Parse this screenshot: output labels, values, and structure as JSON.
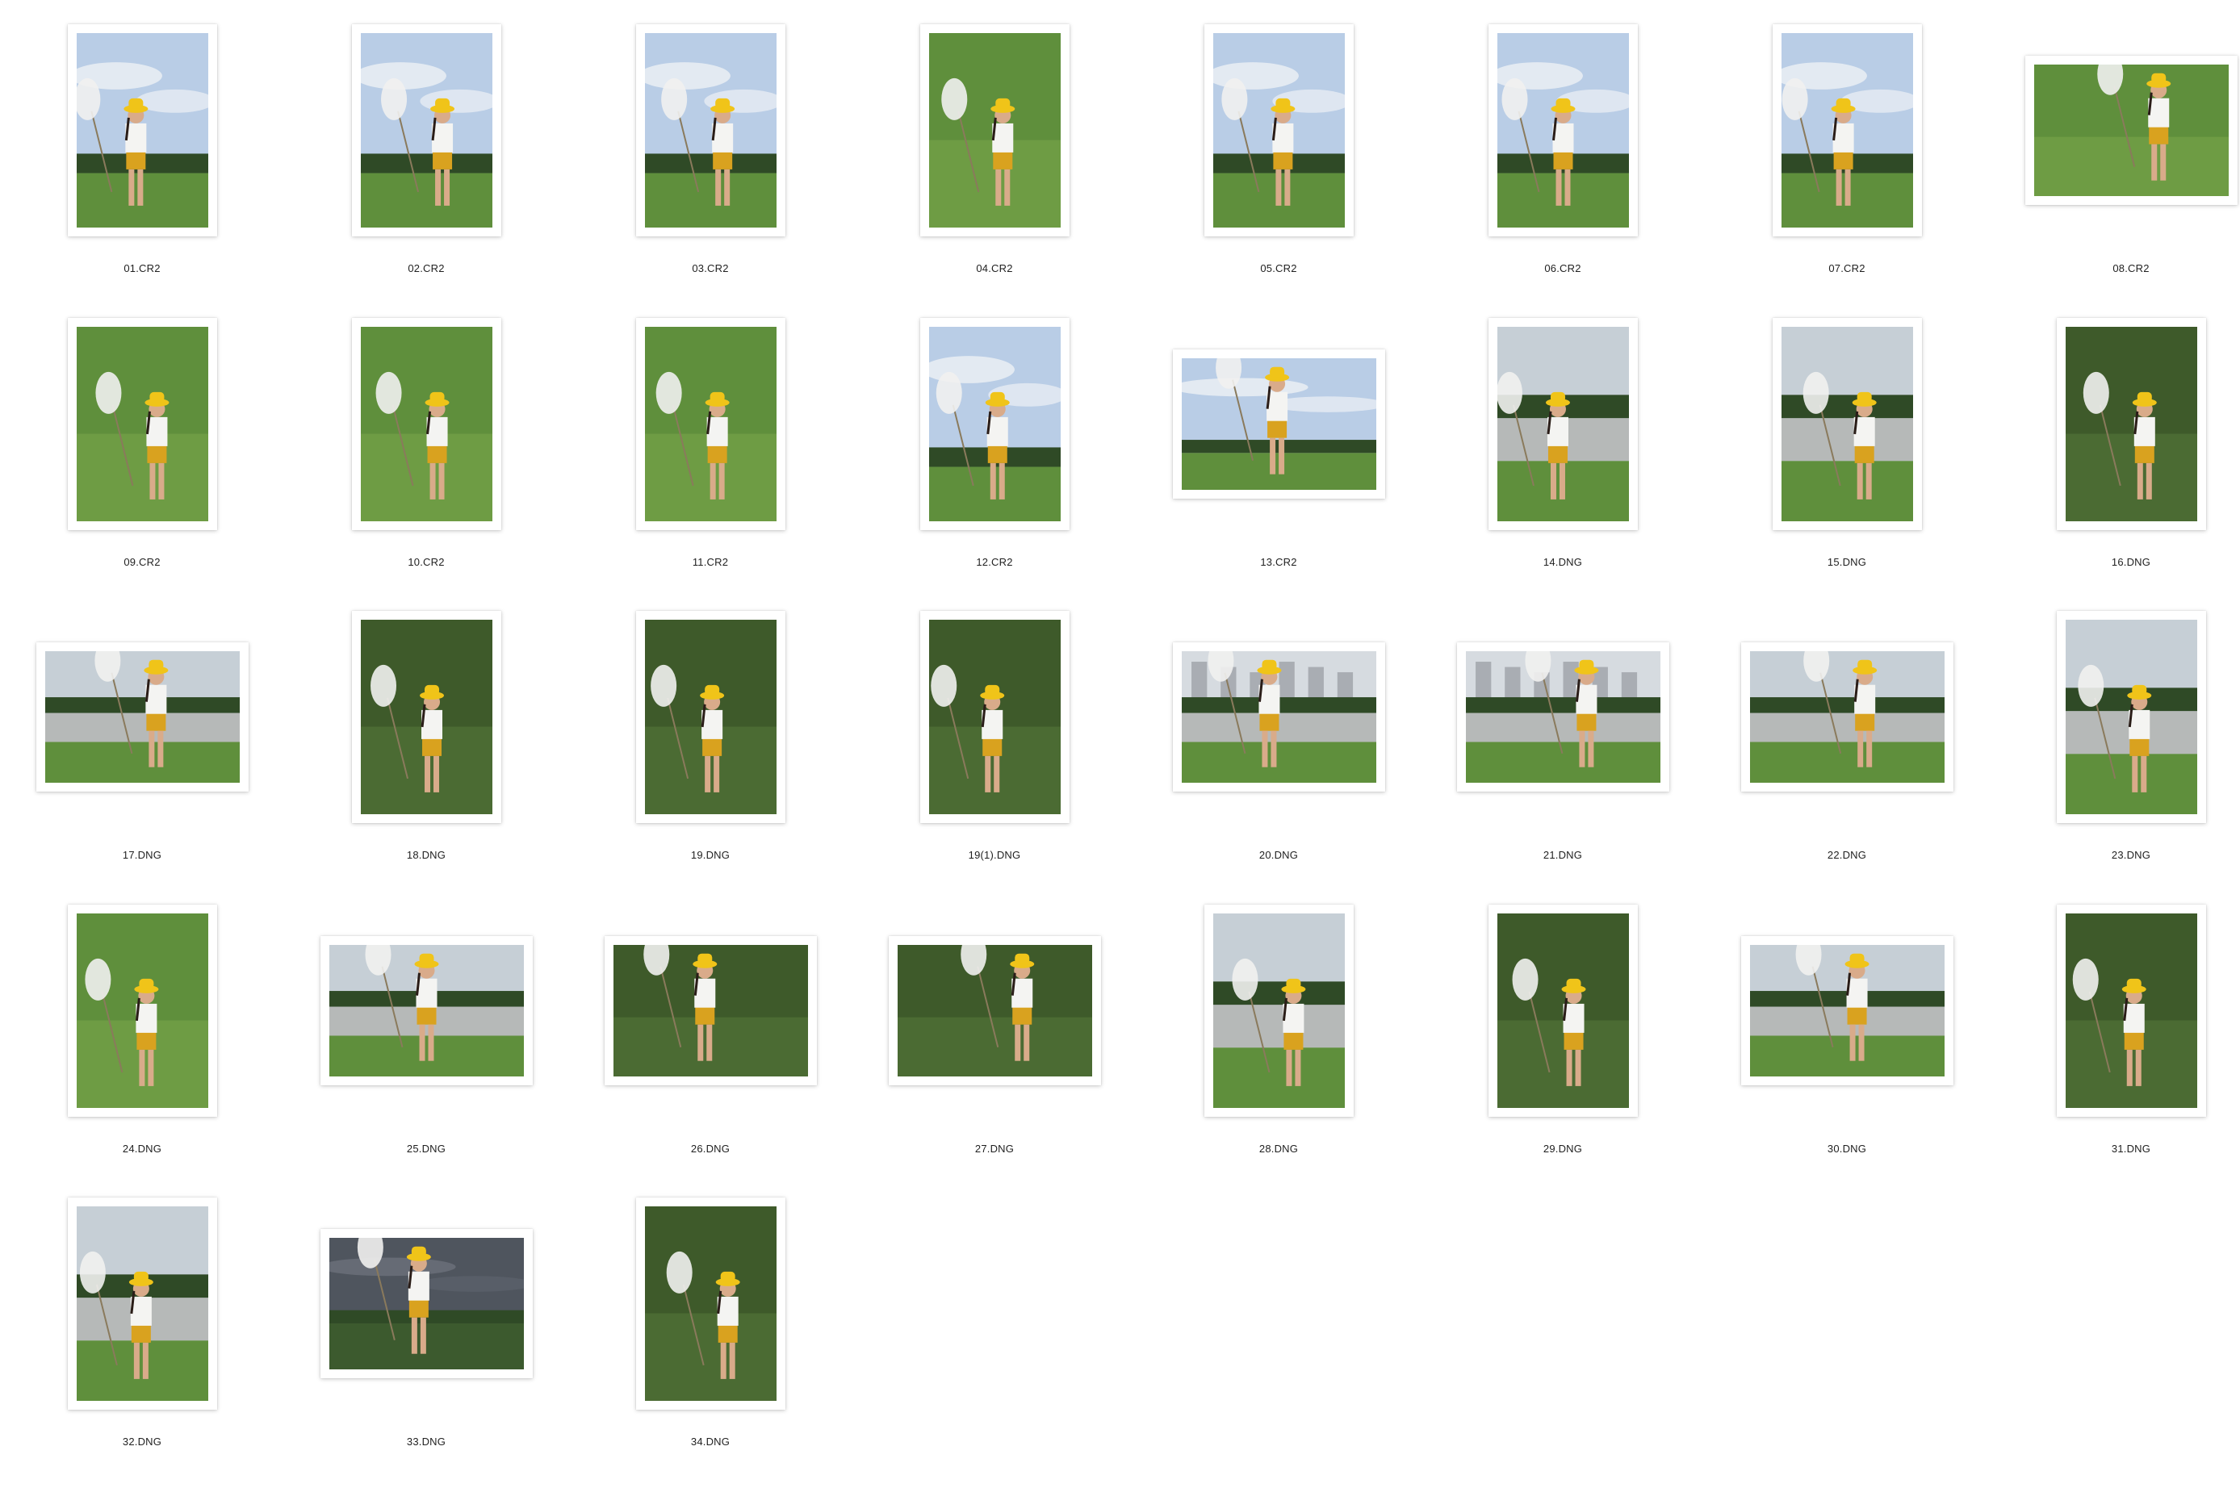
{
  "window": {
    "view": "icon-grid"
  },
  "files": [
    {
      "name": "01.CR2",
      "orientation": "portrait",
      "scene": "sky"
    },
    {
      "name": "02.CR2",
      "orientation": "portrait",
      "scene": "sky"
    },
    {
      "name": "03.CR2",
      "orientation": "portrait",
      "scene": "sky"
    },
    {
      "name": "04.CR2",
      "orientation": "portrait",
      "scene": "grass"
    },
    {
      "name": "05.CR2",
      "orientation": "portrait",
      "scene": "sky"
    },
    {
      "name": "06.CR2",
      "orientation": "portrait",
      "scene": "sky"
    },
    {
      "name": "07.CR2",
      "orientation": "portrait",
      "scene": "sky"
    },
    {
      "name": "08.CR2",
      "orientation": "landscape",
      "scene": "grass"
    },
    {
      "name": "09.CR2",
      "orientation": "portrait",
      "scene": "grass"
    },
    {
      "name": "10.CR2",
      "orientation": "portrait",
      "scene": "grass"
    },
    {
      "name": "11.CR2",
      "orientation": "portrait",
      "scene": "grass"
    },
    {
      "name": "12.CR2",
      "orientation": "portrait",
      "scene": "sky"
    },
    {
      "name": "13.CR2",
      "orientation": "landscape",
      "scene": "sky"
    },
    {
      "name": "14.DNG",
      "orientation": "portrait",
      "scene": "water"
    },
    {
      "name": "15.DNG",
      "orientation": "portrait",
      "scene": "water"
    },
    {
      "name": "16.DNG",
      "orientation": "portrait",
      "scene": "dark"
    },
    {
      "name": "17.DNG",
      "orientation": "landscape",
      "scene": "water"
    },
    {
      "name": "18.DNG",
      "orientation": "portrait",
      "scene": "dark"
    },
    {
      "name": "19.DNG",
      "orientation": "portrait",
      "scene": "dark"
    },
    {
      "name": "19(1).DNG",
      "orientation": "portrait",
      "scene": "dark"
    },
    {
      "name": "20.DNG",
      "orientation": "landscape",
      "scene": "city"
    },
    {
      "name": "21.DNG",
      "orientation": "landscape",
      "scene": "city"
    },
    {
      "name": "22.DNG",
      "orientation": "landscape",
      "scene": "water"
    },
    {
      "name": "23.DNG",
      "orientation": "portrait",
      "scene": "water"
    },
    {
      "name": "24.DNG",
      "orientation": "portrait",
      "scene": "grass"
    },
    {
      "name": "25.DNG",
      "orientation": "landscape",
      "scene": "water"
    },
    {
      "name": "26.DNG",
      "orientation": "landscape",
      "scene": "dark"
    },
    {
      "name": "27.DNG",
      "orientation": "landscape",
      "scene": "dark"
    },
    {
      "name": "28.DNG",
      "orientation": "portrait",
      "scene": "water"
    },
    {
      "name": "29.DNG",
      "orientation": "portrait",
      "scene": "dark"
    },
    {
      "name": "30.DNG",
      "orientation": "landscape",
      "scene": "water"
    },
    {
      "name": "31.DNG",
      "orientation": "portrait",
      "scene": "dark"
    },
    {
      "name": "32.DNG",
      "orientation": "portrait",
      "scene": "water"
    },
    {
      "name": "33.DNG",
      "orientation": "landscape",
      "scene": "storm"
    },
    {
      "name": "34.DNG",
      "orientation": "portrait",
      "scene": "dark"
    }
  ],
  "palette": {
    "sky": "#b9cde6",
    "cloud": "#eef1f5",
    "grass": "#5f8f3c",
    "grass_dark": "#3e5a2a",
    "water": "#b6b9b8",
    "tree": "#2f4a26",
    "shirt": "#f4f4f2",
    "shorts": "#d9a21f",
    "hat": "#f0c419",
    "skin": "#d9ab8a",
    "hair": "#2a1d18",
    "net": "#f1f1ef",
    "storm": "#4f555e",
    "city": "#a9adb3"
  }
}
